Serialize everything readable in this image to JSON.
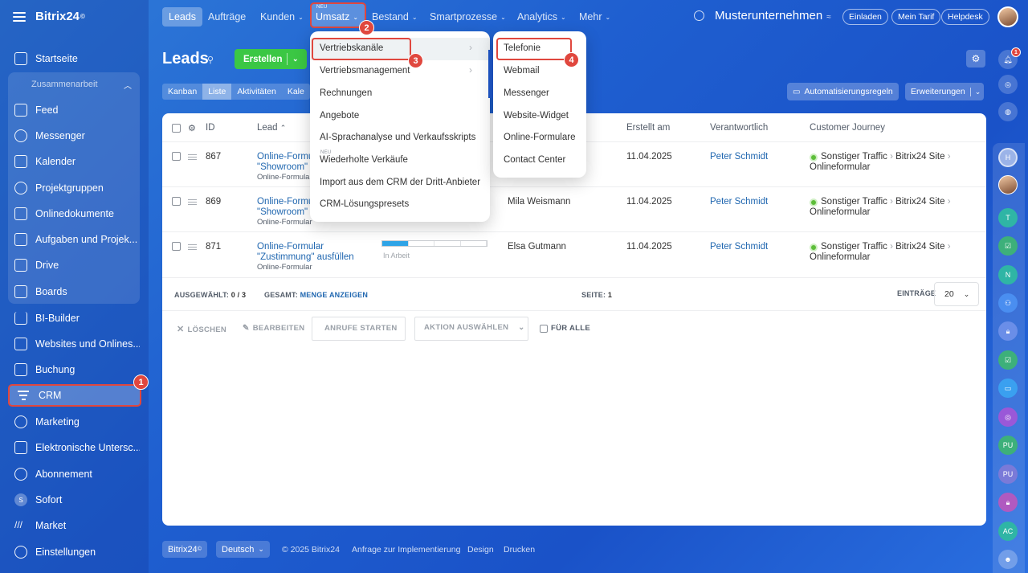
{
  "app": {
    "logo": "Bitrix24",
    "logo_mark": "©"
  },
  "sidebar": {
    "items_top": [
      {
        "label": "Startseite",
        "icon": "home-icon"
      }
    ],
    "group_label": "Zusammenarbeit",
    "group_items": [
      {
        "label": "Feed",
        "icon": "feed-icon"
      },
      {
        "label": "Messenger",
        "icon": "messenger-icon"
      },
      {
        "label": "Kalender",
        "icon": "calendar-icon"
      },
      {
        "label": "Projektgruppen",
        "icon": "groups-icon"
      },
      {
        "label": "Onlinedokumente",
        "icon": "document-icon"
      },
      {
        "label": "Aufgaben und Projek...",
        "icon": "tasks-icon"
      },
      {
        "label": "Drive",
        "icon": "drive-icon"
      },
      {
        "label": "Boards",
        "icon": "boards-icon"
      }
    ],
    "items_bottom": [
      {
        "label": "BI-Builder",
        "icon": "bi-chart-icon"
      },
      {
        "label": "Websites und Onlines...",
        "icon": "cart-icon"
      },
      {
        "label": "Buchung",
        "icon": "booking-icon"
      },
      {
        "label": "CRM",
        "icon": "crm-filter-icon"
      },
      {
        "label": "Marketing",
        "icon": "marketing-icon"
      },
      {
        "label": "Elektronische Untersc...",
        "icon": "signature-icon"
      },
      {
        "label": "Abonnement",
        "icon": "subscription-icon"
      },
      {
        "label": "Sofort",
        "icon": "sofort-icon",
        "avatar_letter": "S"
      },
      {
        "label": "Market",
        "icon": "market-icon"
      },
      {
        "label": "Einstellungen",
        "icon": "settings-icon"
      }
    ]
  },
  "topnav": {
    "tabs": [
      {
        "label": "Leads"
      },
      {
        "label": "Aufträge"
      },
      {
        "label": "Kunden",
        "caret": "⌄"
      },
      {
        "label": "Umsatz",
        "caret": "⌄",
        "badge": "NEU"
      },
      {
        "label": "Bestand",
        "caret": "⌄"
      },
      {
        "label": "Smartprozesse",
        "caret": "⌄"
      },
      {
        "label": "Analytics",
        "caret": "⌄"
      },
      {
        "label": "Mehr",
        "caret": "⌄"
      }
    ],
    "company": "Musterunternehmen",
    "buttons": {
      "invite": "Einladen",
      "plan": "Mein Tarif",
      "help": "Helpdesk"
    }
  },
  "page": {
    "title": "Leads",
    "create_button": "Erstellen",
    "view_tabs": [
      "Kanban",
      "Liste",
      "Aktivitäten",
      "Kale"
    ],
    "automation_button": "Automatisierungsregeln",
    "extensions_button": "Erweiterungen"
  },
  "table": {
    "headers": {
      "id": "ID",
      "lead": "Lead",
      "created": "Erstellt am",
      "responsible": "Verantwortlich",
      "journey": "Customer Journey"
    },
    "rows": [
      {
        "id": "867",
        "title1": "Online-Formul",
        "title2": "\"Showroom\"",
        "source": "Online-Formular",
        "contact": "",
        "created": "11.04.2025",
        "responsible": "Peter Schmidt",
        "journey1": "Sonstiger Traffic",
        "journey2": "Bitrix24 Site",
        "journey3": "Onlineformular"
      },
      {
        "id": "869",
        "title1": "Online-Formu",
        "title2": "\"Showroom\"",
        "source": "Online-Formular",
        "contact": "Mila Weismann",
        "created": "11.04.2025",
        "responsible": "Peter Schmidt",
        "journey1": "Sonstiger Traffic",
        "journey2": "Bitrix24 Site",
        "journey3": "Onlineformular"
      },
      {
        "id": "871",
        "title1": "Online-Formular",
        "title2": "\"Zustimmung\" ausfüllen",
        "source": "Online-Formular",
        "status": "In Arbeit",
        "progress_segments_filled": 1,
        "progress_segments_total": 4,
        "contact": "Elsa Gutmann",
        "created": "11.04.2025",
        "responsible": "Peter Schmidt",
        "journey1": "Sonstiger Traffic",
        "journey2": "Bitrix24 Site",
        "journey3": "Onlineformular"
      }
    ],
    "footer": {
      "selected_label": "AUSGEWÄHLT:",
      "selected_value": "0 / 3",
      "total_label": "GESAMT:",
      "total_link": "MENGE ANZEIGEN",
      "page_label": "SEITE:",
      "page_value": "1",
      "entries_label": "EINTRÄGE",
      "entries_value": "20"
    },
    "actions": {
      "delete": "LÖSCHEN",
      "edit": "BEARBEITEN",
      "calls": "ANRUFE STARTEN",
      "select_action": "AKTION AUSWÄHLEN",
      "for_all": "FÜR ALLE"
    }
  },
  "umsatz_menu": {
    "items": [
      {
        "label": "Vertriebskanäle",
        "submenu": true
      },
      {
        "label": "Vertriebsmanagement",
        "submenu": true
      },
      {
        "label": "Rechnungen"
      },
      {
        "label": "Angebote"
      },
      {
        "label": "AI-Sprachanalyse und Verkaufsskripts"
      },
      {
        "label": "Wiederholte Verkäufe",
        "badge": "NEU"
      },
      {
        "label": "Import aus dem CRM der Dritt-Anbieter"
      },
      {
        "label": "CRM-Lösungspresets"
      }
    ]
  },
  "channels_menu": {
    "items": [
      "Telefonie",
      "Webmail",
      "Messenger",
      "Website-Widget",
      "Online-Formulare",
      "Contact Center"
    ]
  },
  "step_badges": [
    "1",
    "2",
    "3",
    "4"
  ],
  "rightrail": {
    "notification_count": "1",
    "avatars": [
      "H",
      "T",
      "N",
      "PU",
      "PU",
      "AC"
    ]
  },
  "bottom": {
    "logo": "Bitrix24",
    "language": "Deutsch",
    "copyright": "© 2025 Bitrix24",
    "links": [
      "Anfrage zur Implementierung",
      "Design",
      "Drucken"
    ]
  },
  "colors": {
    "accent_green": "#3bc744",
    "highlight_red": "#e0473e",
    "link_blue": "#2067b0"
  }
}
